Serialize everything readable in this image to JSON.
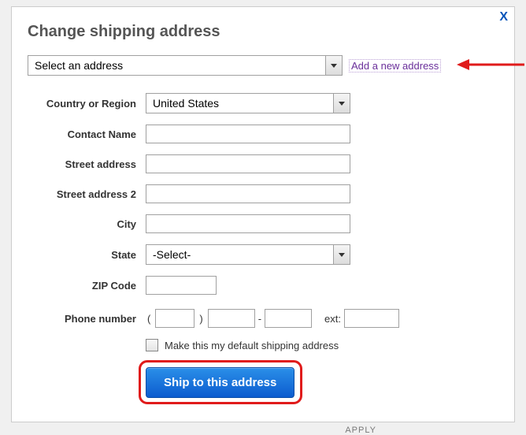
{
  "modal": {
    "title": "Change shipping address",
    "close_label": "X"
  },
  "top": {
    "address_select": "Select an address",
    "add_link": "Add a new address"
  },
  "labels": {
    "country": "Country or Region",
    "contact": "Contact Name",
    "street1": "Street address",
    "street2": "Street address 2",
    "city": "City",
    "state": "State",
    "zip": "ZIP Code",
    "phone": "Phone number",
    "ext": "ext:",
    "default_check": "Make this my default shipping address",
    "submit": "Ship to this address"
  },
  "values": {
    "country": "United States",
    "contact": "",
    "street1": "",
    "street2": "",
    "city": "",
    "state": "-Select-",
    "zip": "",
    "phone1": "",
    "phone2": "",
    "phone3": "",
    "ext": ""
  },
  "footer": {
    "apply": "APPLY"
  }
}
